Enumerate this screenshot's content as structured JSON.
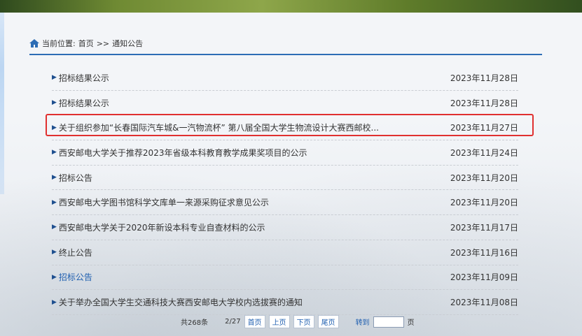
{
  "breadcrumb": {
    "prefix": "当前位置:",
    "home": "首页",
    "sep": ">>",
    "current": "通知公告"
  },
  "notices": [
    {
      "title": "招标结果公示",
      "date": "2023年11月28日"
    },
    {
      "title": "招标结果公示",
      "date": "2023年11月28日"
    },
    {
      "title": "关于组织参加“长春国际汽车城&一汽物流杯” 第八届全国大学生物流设计大赛西邮校...",
      "date": "2023年11月27日"
    },
    {
      "title": "西安邮电大学关于推荐2023年省级本科教育教学成果奖项目的公示",
      "date": "2023年11月24日"
    },
    {
      "title": "招标公告",
      "date": "2023年11月20日"
    },
    {
      "title": "西安邮电大学图书馆科学文库单一来源采购征求意见公示",
      "date": "2023年11月20日"
    },
    {
      "title": "西安邮电大学关于2020年新设本科专业自查材料的公示",
      "date": "2023年11月17日"
    },
    {
      "title": "终止公告",
      "date": "2023年11月16日"
    },
    {
      "title": "招标公告",
      "date": "2023年11月09日"
    },
    {
      "title": "关于举办全国大学生交通科技大赛西安邮电大学校内选拔赛的通知",
      "date": "2023年11月08日"
    }
  ],
  "pager": {
    "total": "共268条",
    "page": "2/27",
    "first": "首页",
    "prev": "上页",
    "next": "下页",
    "last": "尾页",
    "goto": "转到",
    "goto_value": "",
    "page_unit": "页"
  },
  "colors": {
    "accent": "#1f5fb0",
    "divider": "#2d6db5",
    "highlight_box": "#e03030"
  },
  "icons": {
    "home": "home-icon",
    "bullet": "triangle-right-icon"
  }
}
